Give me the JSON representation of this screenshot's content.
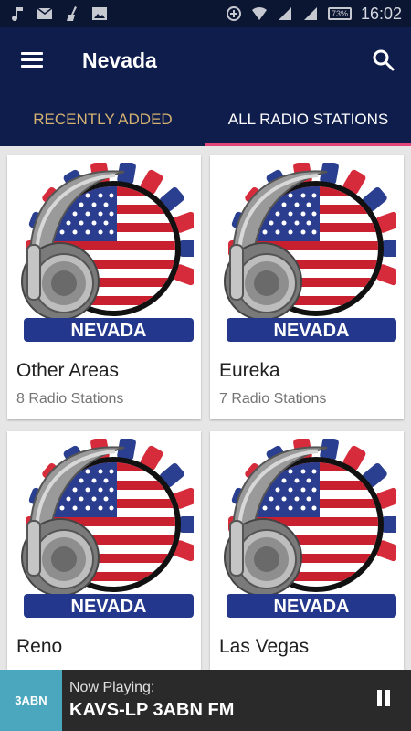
{
  "status_bar": {
    "time": "16:02",
    "battery": "73%",
    "left_icons": [
      "music-note-icon",
      "mail-icon",
      "broom-icon",
      "image-icon"
    ],
    "right_icons": [
      "data-saver-icon",
      "wifi-icon",
      "signal-icon",
      "signal-2-icon",
      "battery-icon"
    ]
  },
  "app_bar": {
    "title": "Nevada",
    "menu_icon": "hamburger-menu-icon",
    "search_icon": "search-icon"
  },
  "tabs": [
    {
      "label": "RECENTLY ADDED",
      "active": false
    },
    {
      "label": "ALL RADIO STATIONS",
      "active": true
    }
  ],
  "cards": [
    {
      "name": "Other Areas",
      "count": "8 Radio Stations",
      "banner": "NEVADA"
    },
    {
      "name": "Eureka",
      "count": "7 Radio Stations",
      "banner": "NEVADA"
    },
    {
      "name": "Reno",
      "count": "",
      "banner": "NEVADA"
    },
    {
      "name": "Las Vegas",
      "count": "",
      "banner": "NEVADA"
    }
  ],
  "player": {
    "logo_text": "3ABN",
    "label": "Now Playing:",
    "title": "KAVS-LP 3ABN FM",
    "pause_icon": "pause-icon"
  },
  "colors": {
    "app_bar": "#0f1d4d",
    "status_bar": "#0b1633",
    "tab_inactive": "#d4b270",
    "tab_indicator": "#e4457a",
    "player_bg": "#2a2a2a",
    "player_logo_bg": "#4aa7bd"
  }
}
